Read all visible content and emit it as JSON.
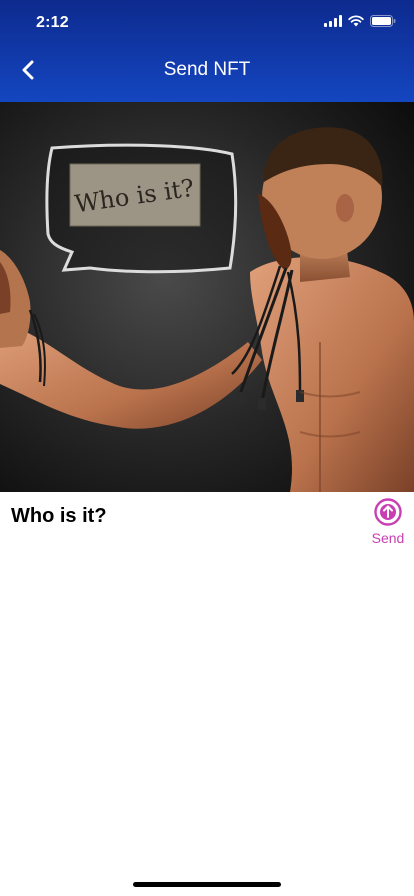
{
  "status_bar": {
    "time": "2:12"
  },
  "nav": {
    "title": "Send NFT"
  },
  "nft": {
    "image_text": "Who is it?",
    "title": "Who is it?"
  },
  "actions": {
    "send_label": "Send"
  },
  "colors": {
    "header_top": "#0d2a8e",
    "header_bottom": "#1446c0",
    "accent": "#c93fb3"
  },
  "icons": [
    "signal-icon",
    "wifi-icon",
    "battery-icon",
    "back-chevron-icon",
    "send-arrow-up-icon"
  ]
}
